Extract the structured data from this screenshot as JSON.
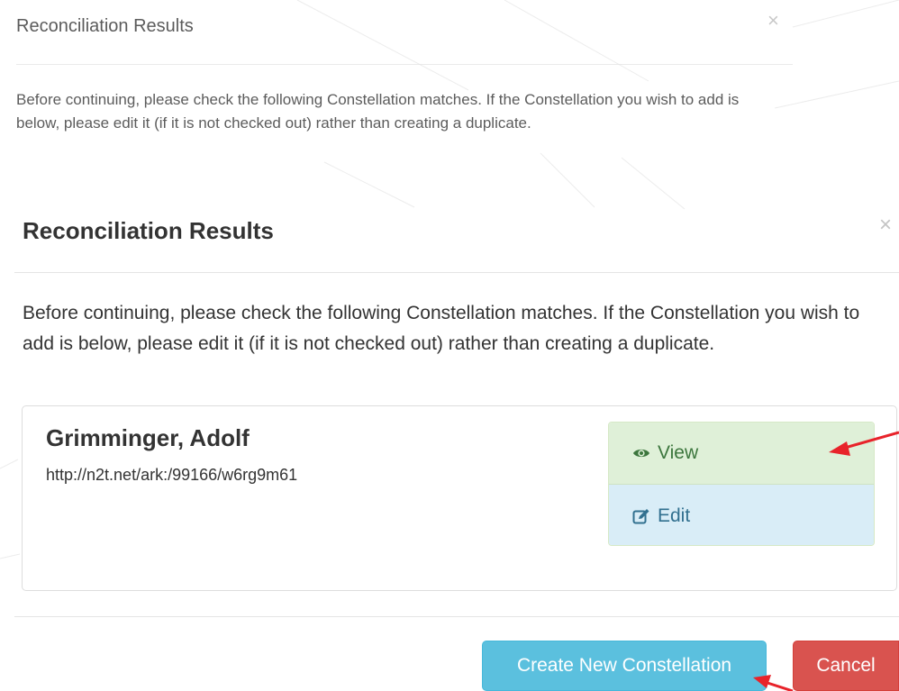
{
  "background_modal": {
    "title": "Reconciliation Results",
    "close": "×",
    "message": "Before continuing, please check the following Constellation matches. If the Constellation you wish to add is below, please edit it (if it is not checked out) rather than creating a duplicate."
  },
  "modal": {
    "title": "Reconciliation Results",
    "close": "×",
    "message": "Before continuing, please check the following Constellation matches. If the Constellation you wish to add is below, please edit it (if it is not checked out) rather than creating a duplicate."
  },
  "result": {
    "name": "Grimminger, Adolf",
    "url": "http://n2t.net/ark:/99166/w6rg9m61",
    "actions": {
      "view_label": "View",
      "view_icon": "eye-icon",
      "edit_label": "Edit",
      "edit_icon": "edit-icon"
    }
  },
  "footer": {
    "create_label": "Create New Constellation",
    "cancel_label": "Cancel"
  },
  "colors": {
    "view_bg": "#dff0d8",
    "edit_bg": "#d9edf7",
    "create_bg": "#5bc0de",
    "cancel_bg": "#d9534f",
    "annotation_arrow": "#e8232a"
  }
}
